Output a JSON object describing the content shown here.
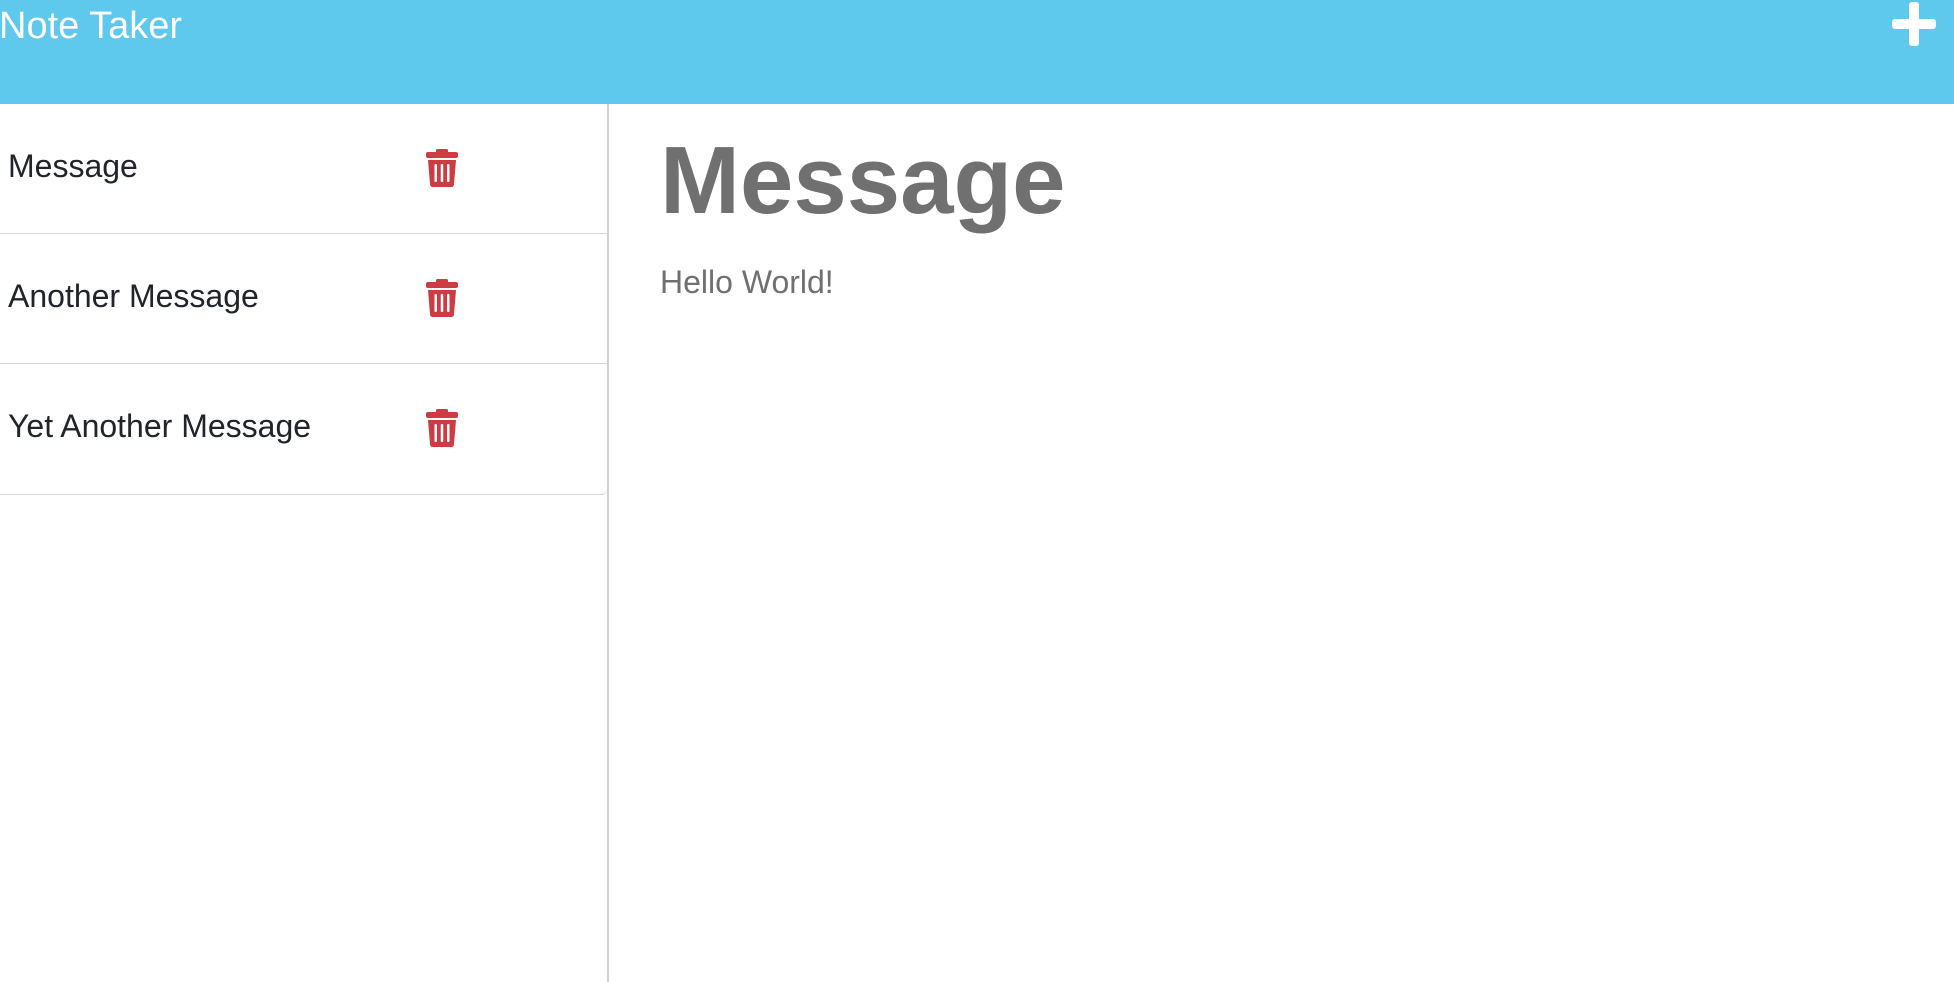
{
  "header": {
    "brand": "Note Taker",
    "new_note_icon": "plus-icon"
  },
  "sidebar": {
    "notes": [
      {
        "title": "Message",
        "delete_icon": "trash-icon"
      },
      {
        "title": "Another Message",
        "delete_icon": "trash-icon"
      },
      {
        "title": "Yet Another Message",
        "delete_icon": "trash-icon"
      }
    ]
  },
  "main": {
    "note_title": "Message",
    "note_text": "Hello World!"
  },
  "colors": {
    "navbar": "#5ec8ed",
    "delete": "#cf3b42",
    "note_text": "#707070"
  }
}
